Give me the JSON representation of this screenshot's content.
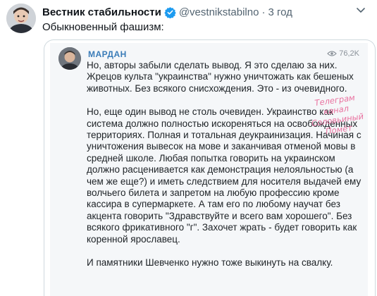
{
  "tweet": {
    "author_name": "Вестник стабильности",
    "handle": "@vestnikstabilno",
    "separator": "·",
    "time": "3 год",
    "text": "Обыкновенный фашизм:",
    "more_icon": "chevron-down-icon"
  },
  "embedded_post": {
    "channel_name": "МАРДАН",
    "views": "76,2K",
    "paragraphs": [
      "Но, авторы забыли сделать вывод. Я это сделаю за них. Жрецов культа \"украинства\" нужно уничтожать как бешеных животных. Без всякого снисхождения. Это - из очевидного.",
      "Но, еще один вывод не столь очевиден. Украинство как система должно полностью искореняться на освобожденных территориях. Полная и тотальная деукраинизация. Начиная с уничтожения вывесок на мове и заканчивая отменой мовы в средней школе. Любая попытка говорить на украинском должно расценивается как демонстрация нелояльностью (а чем же еще?) и иметь следствием для носителя выдачей ему волчьего билета и запретом на любую профессию кроме кассира в супермаркете. А там его по любому научат без акцента говорить \"Здравствуйте и всего вам хорошего\". Без всякого фрикативного \"г\". Захочет жрать - будет говорить как коренной ярославец.",
      "И памятники Шевченко нужно тоже выкинуть на свалку."
    ],
    "watermark_line1": "Телеграм канал",
    "watermark_line2": "Соловьиный Помёт"
  },
  "colors": {
    "channel_name": "#3a7cb8",
    "watermark": "#e9719f",
    "verified": "#1d9bf0"
  }
}
